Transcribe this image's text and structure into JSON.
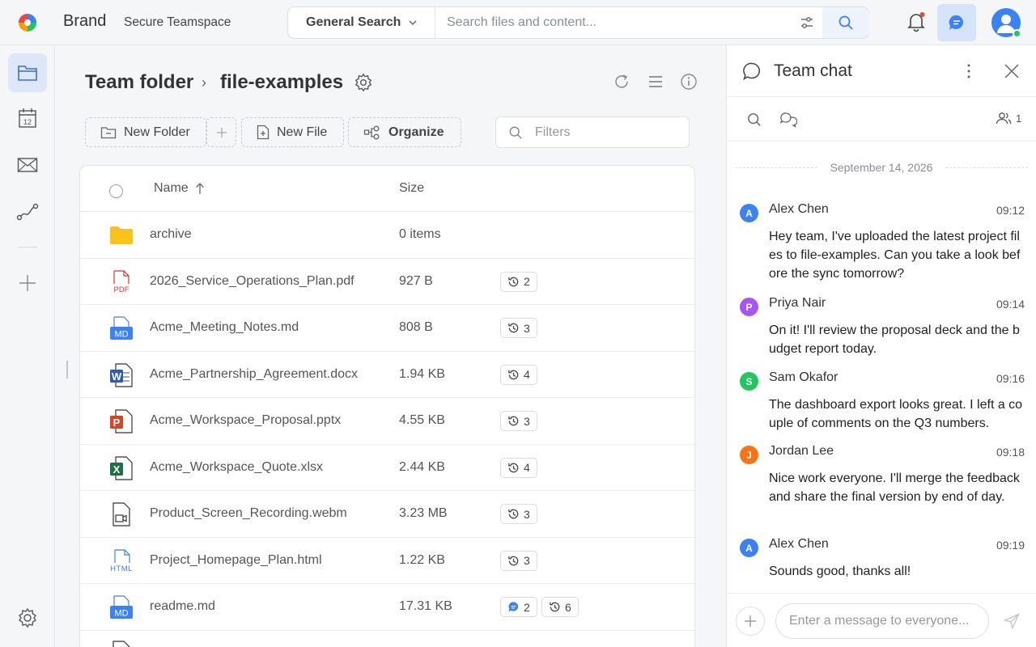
{
  "header": {
    "brand": "Brand",
    "teamspace": "Secure Teamspace",
    "search_scope": "General Search",
    "search_placeholder": "Search files and content...",
    "colors": {
      "accent": "#3b82f6",
      "chat_toggle_bg": "#d5e4fb",
      "online": "#22c55e"
    }
  },
  "rail": {
    "items": [
      "files-icon",
      "calendar-icon",
      "mail-icon",
      "workflow-icon",
      "add-icon"
    ],
    "calendar_day": "12",
    "active": "files-icon",
    "bottom": "settings-icon"
  },
  "main": {
    "breadcrumb_root": "Team folder",
    "breadcrumb_sep": "›",
    "breadcrumb_current": "file-examples",
    "toolbar": {
      "new_folder": "New Folder",
      "new_file": "New File",
      "organize": "Organize",
      "filter_placeholder": "Filters"
    },
    "table": {
      "col_name": "Name",
      "col_size": "Size",
      "rows": [
        {
          "name": "archive",
          "size": "0 items",
          "icon": "folder-icon",
          "versions": ""
        },
        {
          "name": "2026_Service_Operations_Plan.pdf",
          "size": "927 B",
          "icon": "pdf-icon",
          "versions": "2"
        },
        {
          "name": "Acme_Meeting_Notes.md",
          "size": "808 B",
          "icon": "markdown-icon",
          "versions": "3"
        },
        {
          "name": "Acme_Partnership_Agreement.docx",
          "size": "1.94 KB",
          "icon": "word-icon",
          "versions": "4"
        },
        {
          "name": "Acme_Workspace_Proposal.pptx",
          "size": "4.55 KB",
          "icon": "powerpoint-icon",
          "versions": "3"
        },
        {
          "name": "Acme_Workspace_Quote.xlsx",
          "size": "2.44 KB",
          "icon": "excel-icon",
          "versions": "4"
        },
        {
          "name": "Product_Screen_Recording.webm",
          "size": "3.23 MB",
          "icon": "video-icon",
          "versions": "3"
        },
        {
          "name": "Project_Homepage_Plan.html",
          "size": "1.22 KB",
          "icon": "html-icon",
          "versions": "3"
        },
        {
          "name": "readme.md",
          "size": "17.31 KB",
          "icon": "markdown-icon",
          "versions": "6",
          "comments": "2"
        }
      ]
    }
  },
  "chat": {
    "title": "Team chat",
    "member_count": "1",
    "date": "September 14, 2026",
    "input_placeholder": "Enter a message to everyone...",
    "messages": [
      {
        "initial": "A",
        "author": "Alex Chen",
        "time": "09:12",
        "color": "#3b82f6",
        "text": "Hey team, I've uploaded the latest project files to file-examples. Can you take a look before the sync tomorrow?"
      },
      {
        "initial": "P",
        "author": "Priya Nair",
        "time": "09:14",
        "color": "#a855f7",
        "text": "On it! I'll review the proposal deck and the budget report today."
      },
      {
        "initial": "S",
        "author": "Sam Okafor",
        "time": "09:16",
        "color": "#22c55e",
        "text": "The dashboard export looks great. I left a couple of comments on the Q3 numbers."
      },
      {
        "initial": "J",
        "author": "Jordan Lee",
        "time": "09:18",
        "color": "#f97316",
        "text": "Nice work everyone. I'll merge the feedback and share the final version by end of day."
      },
      {
        "initial": "A",
        "author": "Alex Chen",
        "time": "09:19",
        "color": "#3b82f6",
        "text": "Sounds good, thanks all!"
      }
    ]
  }
}
